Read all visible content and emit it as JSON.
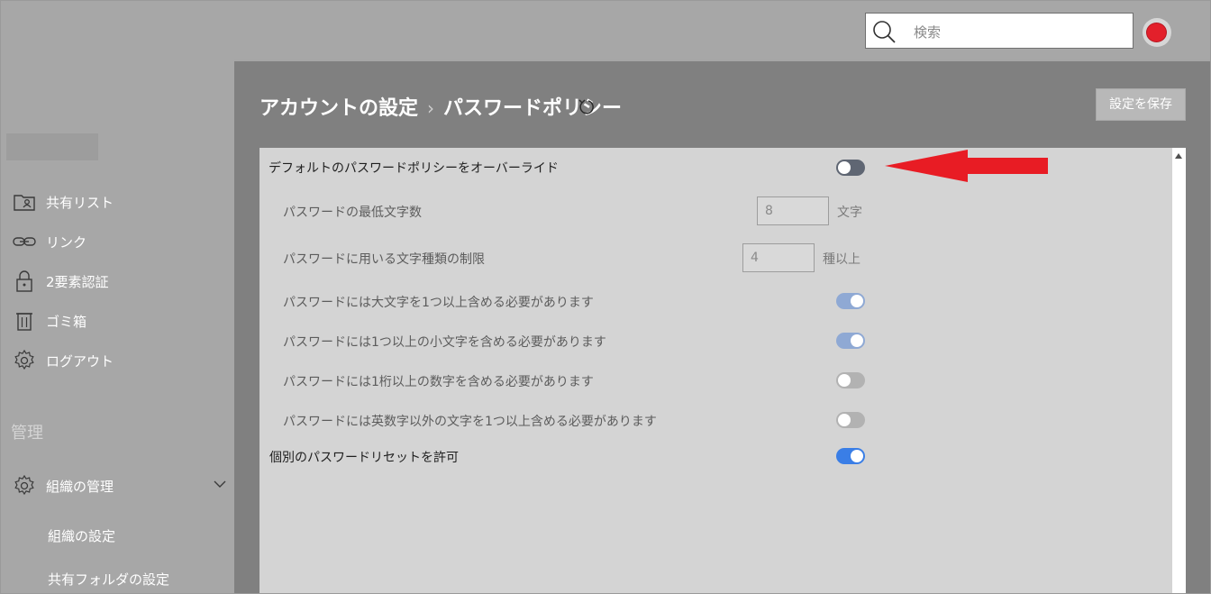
{
  "header": {
    "search_placeholder": "検索"
  },
  "sidebar": {
    "items": [
      {
        "label": "共有リスト",
        "icon": "shared-list-icon"
      },
      {
        "label": "リンク",
        "icon": "link-icon"
      },
      {
        "label": "2要素認証",
        "icon": "lock-icon"
      },
      {
        "label": "ゴミ箱",
        "icon": "trash-icon"
      },
      {
        "label": "ログアウト",
        "icon": "gear-icon"
      }
    ],
    "section_title": "管理",
    "org": {
      "label": "組織の管理",
      "icon": "gear-icon"
    },
    "sub_items": [
      {
        "label": "組織の設定"
      },
      {
        "label": "共有フォルダの設定"
      }
    ]
  },
  "main": {
    "breadcrumb": {
      "parent": "アカウントの設定",
      "separator": "›",
      "current": "パスワードポリシー"
    },
    "save_label": "設定を保存",
    "settings": {
      "override": {
        "label": "デフォルトのパスワードポリシーをオーバーライド",
        "enabled": false
      },
      "min_length": {
        "label": "パスワードの最低文字数",
        "value": "8",
        "unit": "文字"
      },
      "char_types": {
        "label": "パスワードに用いる文字種類の制限",
        "value": "4",
        "unit": "種以上"
      },
      "uppercase": {
        "label": "パスワードには大文字を1つ以上含める必要があります",
        "enabled": true
      },
      "lowercase": {
        "label": "パスワードには1つ以上の小文字を含める必要があります",
        "enabled": true
      },
      "digit": {
        "label": "パスワードには1桁以上の数字を含める必要があります",
        "enabled": false
      },
      "symbol": {
        "label": "パスワードには英数字以外の文字を1つ以上含める必要があります",
        "enabled": false
      },
      "individual_reset": {
        "label": "個別のパスワードリセットを許可",
        "enabled": true
      }
    }
  },
  "colors": {
    "accent_blue": "#3a7ee6",
    "arrow_red": "#e81c24",
    "avatar_red": "#e3202b"
  }
}
